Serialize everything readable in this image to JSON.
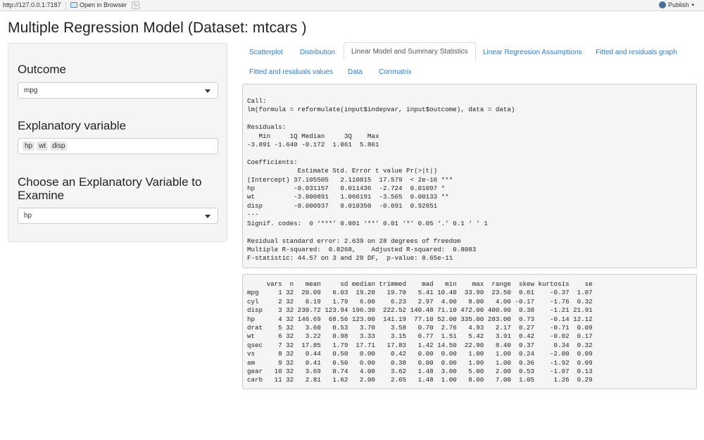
{
  "topbar": {
    "url": "http://127.0.0.1:7187",
    "open_in_browser": "Open in Browser",
    "publish": "Publish",
    "publish_color": "#447099"
  },
  "title": "Multiple Regression Model (Dataset: mtcars )",
  "sidebar": {
    "outcome": {
      "label": "Outcome",
      "value": "mpg"
    },
    "explanatory": {
      "label": "Explanatory variable",
      "chips": [
        "hp",
        "wt",
        "disp"
      ]
    },
    "examine": {
      "label": "Choose an Explanatory Variable to Examine",
      "value": "hp"
    }
  },
  "tabs": [
    {
      "label": "Scatterplot",
      "active": false
    },
    {
      "label": "Distribution",
      "active": false
    },
    {
      "label": "Linear Model and Summary Statistics",
      "active": true
    },
    {
      "label": "Linear Regression Assumptions",
      "active": false
    },
    {
      "label": "Fitted and residuals graph",
      "active": false
    },
    {
      "label": "Fitted and residuals values",
      "active": false
    },
    {
      "label": "Data",
      "active": false
    },
    {
      "label": "Corrmatrix",
      "active": false
    }
  ],
  "colors": {
    "link": "#337ab7",
    "well": "#f5f5f5"
  },
  "summary_output": "Call:\nlm(formula = reformulate(input$indepvar, input$outcome), data = data)\n\nResiduals:\n   Min     1Q Median     3Q    Max \n-3.891 -1.640 -0.172  1.061  5.861 \n\nCoefficients:\n             Estimate Std. Error t value Pr(>|t|)    \n(Intercept) 37.105505   2.110815  17.579  < 2e-16 ***\nhp          -0.031157   0.011436  -2.724  0.01097 *  \nwt          -3.800891   1.066191  -3.565  0.00133 ** \ndisp        -0.000937   0.010350  -0.091  0.92851    \n---\nSignif. codes:  0 ‘***’ 0.001 ‘**’ 0.01 ‘*’ 0.05 ‘.’ 0.1 ‘ ’ 1\n\nResidual standard error: 2.639 on 28 degrees of freedom\nMultiple R-squared:  0.8268,\tAdjusted R-squared:  0.8083 \nF-statistic: 44.57 on 3 and 28 DF,  p-value: 8.65e-11",
  "describe_output": "     vars  n   mean     sd median trimmed    mad   min    max  range  skew kurtosis    se\nmpg     1 32  20.09   6.03  19.20   19.70   5.41 10.40  33.90  23.50  0.61    -0.37  1.07\ncyl     2 32   6.19   1.79   6.00    6.23   2.97  4.00   8.00   4.00 -0.17    -1.76  0.32\ndisp    3 32 230.72 123.94 196.30  222.52 140.48 71.10 472.00 400.90  0.38    -1.21 21.91\nhp      4 32 146.69  68.56 123.00  141.19  77.10 52.00 335.00 283.00  0.73    -0.14 12.12\ndrat    5 32   3.60   0.53   3.70    3.58   0.70  2.76   4.93   2.17  0.27    -0.71  0.09\nwt      6 32   3.22   0.98   3.33    3.15   0.77  1.51   5.42   3.91  0.42    -0.02  0.17\nqsec    7 32  17.85   1.79  17.71   17.83   1.42 14.50  22.90   8.40  0.37     0.34  0.32\nvs      8 32   0.44   0.50   0.00    0.42   0.00  0.00   1.00   1.00  0.24    -2.00  0.09\nam      9 32   0.41   0.50   0.00    0.38   0.00  0.00   1.00   1.00  0.36    -1.92  0.09\ngear   10 32   3.69   0.74   4.00    3.62   1.48  3.00   5.00   2.00  0.53    -1.07  0.13\ncarb   11 32   2.81   1.62   2.00    2.65   1.48  1.00   8.00   7.00  1.05     1.26  0.29"
}
